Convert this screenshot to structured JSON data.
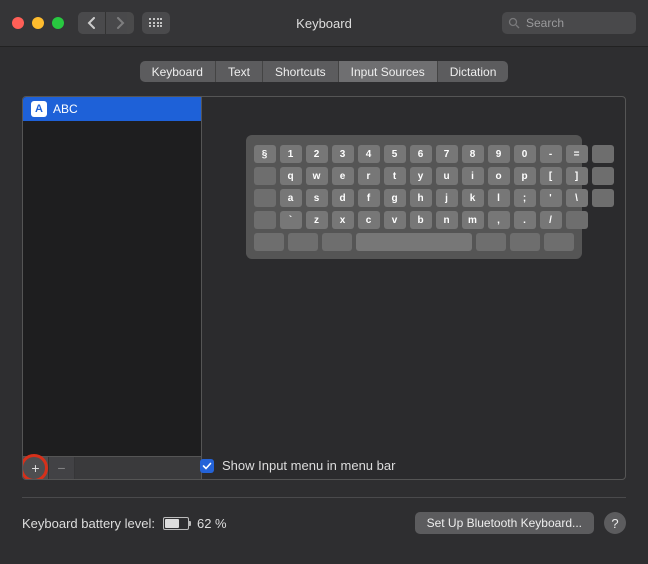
{
  "header": {
    "title": "Keyboard",
    "search_placeholder": "Search"
  },
  "tabs": [
    {
      "label": "Keyboard",
      "active": false
    },
    {
      "label": "Text",
      "active": false
    },
    {
      "label": "Shortcuts",
      "active": false
    },
    {
      "label": "Input Sources",
      "active": true
    },
    {
      "label": "Dictation",
      "active": false
    }
  ],
  "sources": {
    "items": [
      {
        "icon_letter": "A",
        "label": "ABC"
      }
    ],
    "add_label": "+",
    "remove_label": "−"
  },
  "keyboard_preview": {
    "rows": [
      [
        "§",
        "1",
        "2",
        "3",
        "4",
        "5",
        "6",
        "7",
        "8",
        "9",
        "0",
        "-",
        "="
      ],
      [
        "q",
        "w",
        "e",
        "r",
        "t",
        "y",
        "u",
        "i",
        "o",
        "p",
        "[",
        "]"
      ],
      [
        "a",
        "s",
        "d",
        "f",
        "g",
        "h",
        "j",
        "k",
        "l",
        ";",
        "'",
        "\\"
      ],
      [
        "`",
        "z",
        "x",
        "c",
        "v",
        "b",
        "n",
        "m",
        ",",
        ".",
        "/"
      ]
    ]
  },
  "checkbox": {
    "label": "Show Input menu in menu bar",
    "checked": true
  },
  "footer": {
    "battery_label": "Keyboard battery level:",
    "battery_pct_label": "62 %",
    "battery_pct": 62,
    "bluetooth_button": "Set Up Bluetooth Keyboard...",
    "help_label": "?"
  }
}
